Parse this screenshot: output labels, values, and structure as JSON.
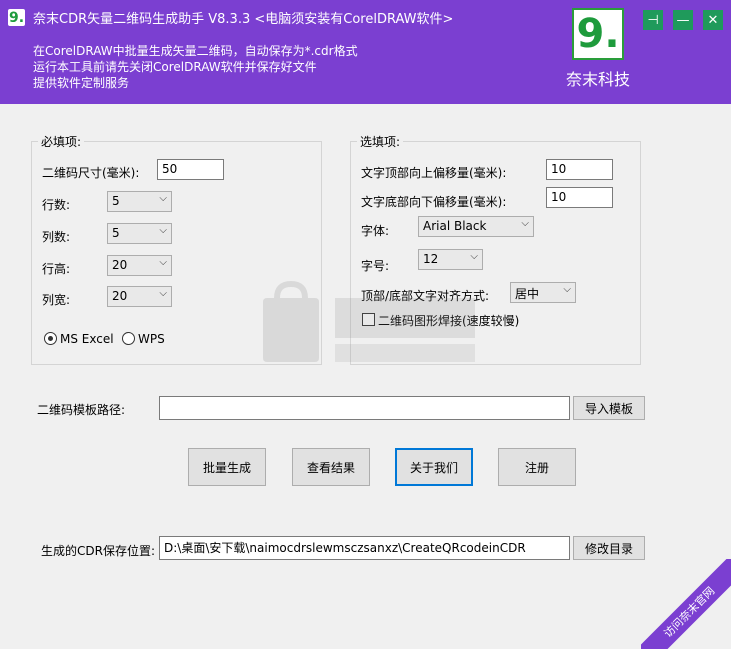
{
  "header": {
    "logo_glyph": "9.",
    "title": "奈末CDR矢量二维码生成助手 V8.3.3  <电脑须安装有CorelDRAW软件>",
    "info_lines": [
      "在CorelDRAW中批量生成矢量二维码，自动保存为*.cdr格式",
      "运行本工具前请先关闭CorelDRAW软件并保存好文件",
      "提供软件定制服务"
    ],
    "brand_glyph": "9.",
    "brand_name": "奈末科技",
    "pin_glyph": "⊣",
    "minimize_glyph": "—",
    "close_glyph": "✕"
  },
  "required": {
    "title": "必填项:",
    "size_label": "二维码尺寸(毫米):",
    "size_value": "50",
    "rows_label": "行数:",
    "rows_value": "5",
    "cols_label": "列数:",
    "cols_value": "5",
    "row_height_label": "行高:",
    "row_height_value": "20",
    "col_width_label": "列宽:",
    "col_width_value": "20",
    "excel_label": "MS Excel",
    "wps_label": "WPS"
  },
  "optional": {
    "title": "选填项:",
    "top_offset_label": "文字顶部向上偏移量(毫米):",
    "top_offset_value": "10",
    "bottom_offset_label": "文字底部向下偏移量(毫米):",
    "bottom_offset_value": "10",
    "font_label": "字体:",
    "font_value": "Arial Black",
    "font_size_label": "字号:",
    "font_size_value": "12",
    "align_label": "顶部/底部文字对齐方式:",
    "align_value": "居中",
    "stitch_label": "二维码图形焊接(速度较慢)"
  },
  "template": {
    "label": "二维码模板路径:",
    "value": "",
    "import_button": "导入模板"
  },
  "actions": {
    "batch": "批量生成",
    "view": "查看结果",
    "about": "关于我们",
    "register": "注册"
  },
  "save": {
    "label": "生成的CDR保存位置:",
    "value": "D:\\桌面\\安下载\\naimocdrslewmsczsanxz\\CreateQRcodeinCDR",
    "change_button": "修改目录"
  },
  "ribbon": "访问奈末官网",
  "colors": {
    "header": "#7b3fd1",
    "window_buttons": "#1f9a5b",
    "brand_green": "#1e9b3c"
  }
}
